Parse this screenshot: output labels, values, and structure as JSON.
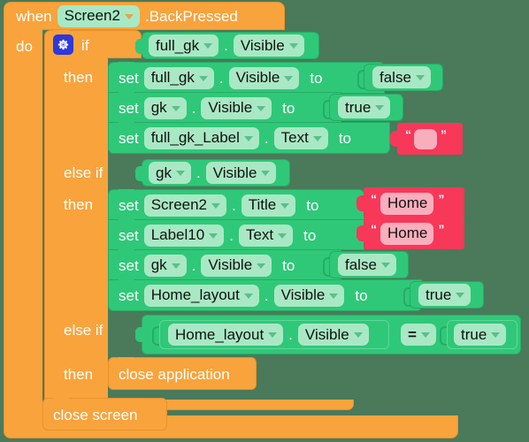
{
  "workspace": {
    "background_color": "#4a7a5a",
    "event_block": {
      "keyword_when": "when",
      "component": "Screen2",
      "event": ".BackPressed",
      "do_label": "do",
      "color": "#f9a33c"
    },
    "control_if": {
      "if_label": "if",
      "mutator_icon": "gear-icon",
      "then_label_1": "then",
      "else_if_label_1": "else if",
      "then_label_2": "then",
      "else_if_label_2": "else if",
      "then_label_3": "then",
      "color": "#f9a33c"
    },
    "condition_1": {
      "component": "full_gk",
      "property": "Visible",
      "dot": "."
    },
    "branch_1": [
      {
        "set_label": "set",
        "component": "full_gk",
        "dot": ".",
        "property": "Visible",
        "to_label": "to",
        "value": "false",
        "value_kind": "logic"
      },
      {
        "set_label": "set",
        "component": "gk",
        "dot": ".",
        "property": "Visible",
        "to_label": "to",
        "value": "true",
        "value_kind": "logic"
      },
      {
        "set_label": "set",
        "component": "full_gk_Label",
        "dot": ".",
        "property": "Text",
        "to_label": "to",
        "value": "",
        "value_kind": "text",
        "open_quote": "“",
        "close_quote": "”"
      }
    ],
    "condition_2": {
      "component": "gk",
      "property": "Visible",
      "dot": "."
    },
    "branch_2": [
      {
        "set_label": "set",
        "component": "Screen2",
        "dot": ".",
        "property": "Title",
        "to_label": "to",
        "value": "Home",
        "value_kind": "text",
        "open_quote": "“",
        "close_quote": "”"
      },
      {
        "set_label": "set",
        "component": "Label10",
        "dot": ".",
        "property": "Text",
        "to_label": "to",
        "value": "Home",
        "value_kind": "text",
        "open_quote": "“",
        "close_quote": "”"
      },
      {
        "set_label": "set",
        "component": "gk",
        "dot": ".",
        "property": "Visible",
        "to_label": "to",
        "value": "false",
        "value_kind": "logic"
      },
      {
        "set_label": "set",
        "component": "Home_layout",
        "dot": ".",
        "property": "Visible",
        "to_label": "to",
        "value": "true",
        "value_kind": "logic"
      }
    ],
    "condition_3": {
      "component": "Home_layout",
      "dot": ".",
      "property": "Visible",
      "operator": "=",
      "right_value": "true"
    },
    "branch_3": [
      {
        "label": "close application"
      }
    ],
    "trailing_statement": {
      "label": "close screen"
    },
    "colors": {
      "event_orange": "#f9a33c",
      "control_orange": "#f9a33c",
      "setter_green": "#2fc878",
      "field_green": "#a9e8c4",
      "text_red": "#f73859",
      "field_pink": "#f9aebd",
      "gear_blue": "#2f38d8",
      "text_white": "#ffffff",
      "text_black": "#111111"
    }
  }
}
